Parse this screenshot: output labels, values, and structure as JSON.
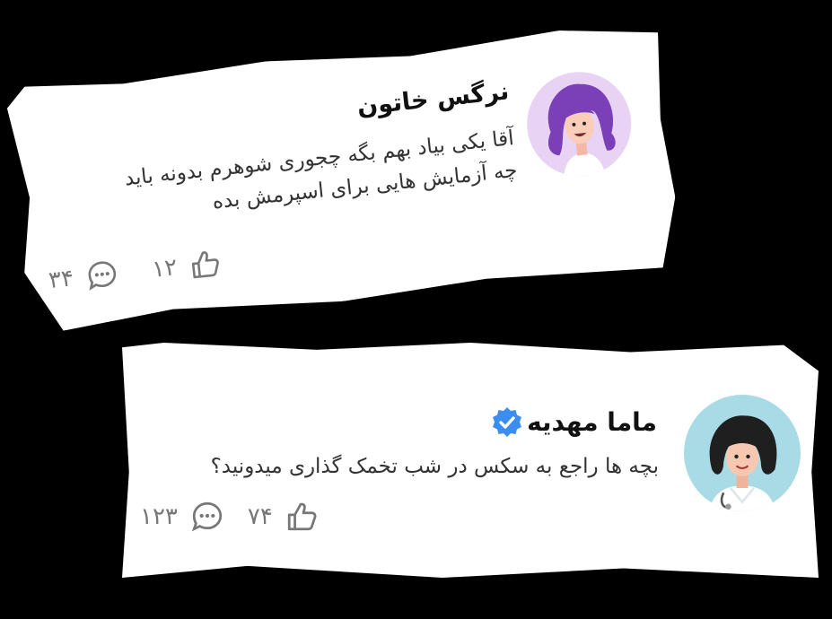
{
  "comments": [
    {
      "author": "نرگس خاتون",
      "lines": [
        "آقا یکی بیاد بهم بگه چجوری شوهرم بدونه باید",
        "چه آزمایش هایی برای اسپرمش بده"
      ],
      "comment_count": "۳۴",
      "like_count": "۱۲",
      "verified": false
    },
    {
      "author": "ماما مهدیه",
      "lines": [
        "بچه ها راجع به سکس در شب تخمک گذاری میدونید؟"
      ],
      "comment_count": "۱۲۳",
      "like_count": "۷۴",
      "verified": true
    }
  ],
  "colors": {
    "verified": "#3b8ef0",
    "avatar1_bg": "#e8d3f5",
    "avatar2_bg": "#a8dbe6",
    "text": "#333333",
    "stats": "#777777"
  },
  "icons": [
    "comment-icon",
    "thumbs-up-icon",
    "verified-badge-icon"
  ]
}
